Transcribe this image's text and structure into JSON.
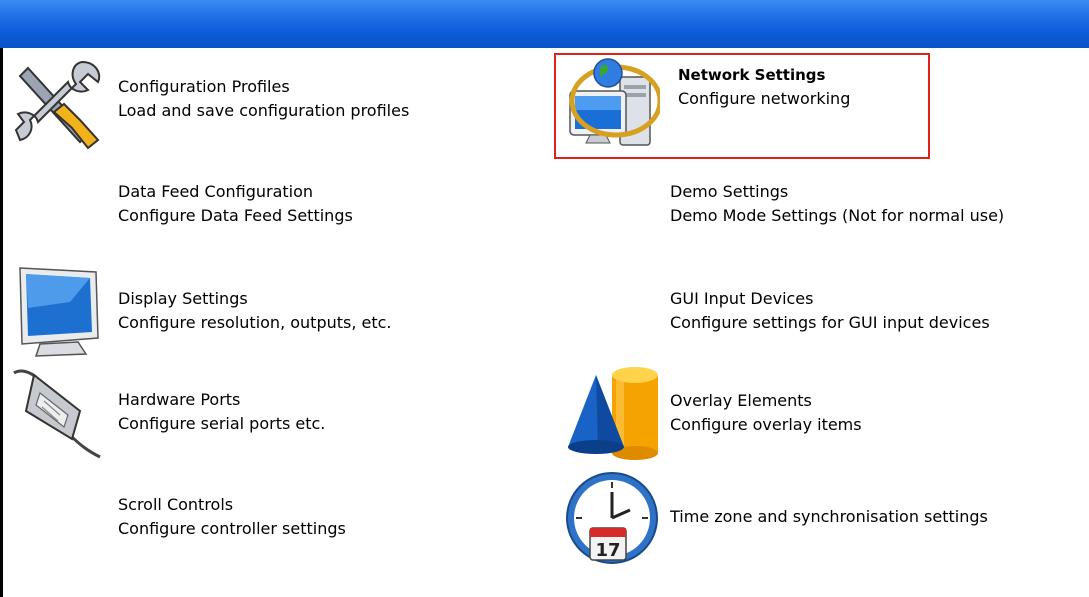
{
  "items": [
    {
      "title": "Configuration Profiles",
      "desc": "Load and save configuration profiles",
      "icon": "tools-icon"
    },
    {
      "title": "Network Settings",
      "desc": "Configure networking",
      "icon": "network-computer-icon"
    },
    {
      "title": "Data Feed Configuration",
      "desc": "Configure Data Feed Settings"
    },
    {
      "title": "Demo Settings",
      "desc": "Demo Mode Settings (Not for normal use)"
    },
    {
      "title": "Display Settings",
      "desc": "Configure resolution, outputs, etc.",
      "icon": "monitor-icon"
    },
    {
      "title": "GUI Input Devices",
      "desc": "Configure settings for GUI input devices"
    },
    {
      "title": "Hardware Ports",
      "desc": "Configure serial ports etc.",
      "icon": "serial-port-icon"
    },
    {
      "title": "Overlay Elements",
      "desc": "Configure overlay items",
      "icon": "shapes-icon"
    },
    {
      "title": "Scroll Controls",
      "desc": "Configure controller settings"
    },
    {
      "title": "Time zone and synchronisation settings",
      "desc": "",
      "icon": "clock-calendar-icon",
      "calendar_day": "17"
    }
  ],
  "colors": {
    "titlebar": "#0d5bd8",
    "highlight": "#e0201c"
  }
}
